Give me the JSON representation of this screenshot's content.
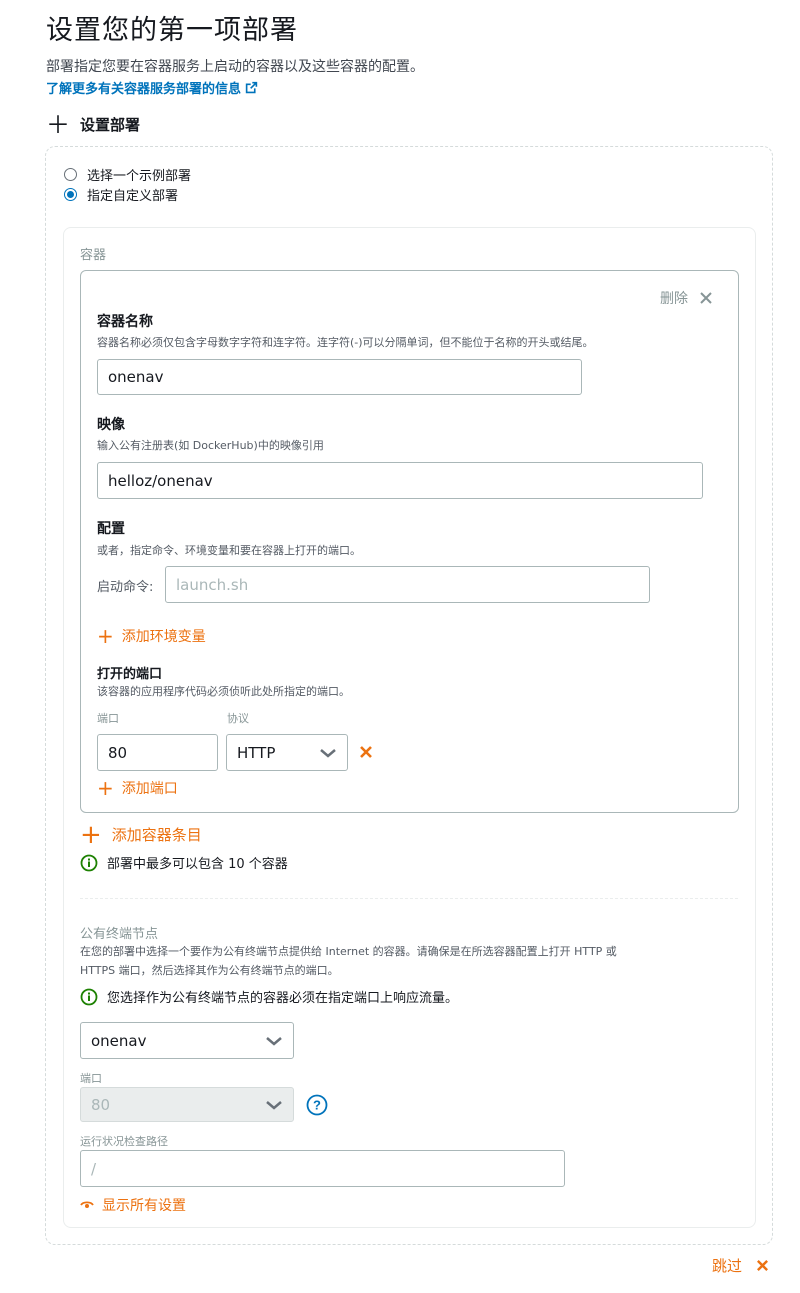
{
  "header": {
    "title": "设置您的第一项部署",
    "description": "部署指定您要在容器服务上启动的容器以及这些容器的配置。",
    "learn_more": "了解更多有关容器服务部署的信息"
  },
  "setup_section": {
    "title": "设置部署",
    "options": [
      {
        "label": "选择一个示例部署",
        "checked": false
      },
      {
        "label": "指定自定义部署",
        "checked": true
      }
    ]
  },
  "containers": {
    "section_label": "容器",
    "card": {
      "delete_label": "删除",
      "name": {
        "title": "容器名称",
        "hint": "容器名称必须仅包含字母数字字符和连字符。连字符(-)可以分隔单词，但不能位于名称的开头或结尾。",
        "value": "onenav"
      },
      "image": {
        "title": "映像",
        "hint": "输入公有注册表(如 DockerHub)中的映像引用",
        "value": "helloz/onenav"
      },
      "config": {
        "title": "配置",
        "hint": "或者，指定命令、环境变量和要在容器上打开的端口。",
        "launch_label": "启动命令:",
        "launch_placeholder": "launch.sh",
        "add_env": "添加环境变量"
      },
      "ports": {
        "title": "打开的端口",
        "hint": "该容器的应用程序代码必须侦听此处所指定的端口。",
        "port_label": "端口",
        "protocol_label": "协议",
        "port_value": "80",
        "protocol_value": "HTTP",
        "add_port": "添加端口"
      }
    },
    "add_container": "添加容器条目",
    "max_info": "部署中最多可以包含 10 个容器"
  },
  "endpoint": {
    "title": "公有终端节点",
    "description_line1": "在您的部署中选择一个要作为公有终端节点提供给 Internet 的容器。请确保是在所选容器配置上打开 HTTP 或",
    "description_line2": "HTTPS 端口，然后选择其作为公有终端节点的端口。",
    "info": "您选择作为公有终端节点的容器必须在指定端口上响应流量。",
    "container_value": "onenav",
    "port_label": "端口",
    "port_value": "80",
    "health_label": "运行状况检查路径",
    "health_value": "/",
    "show_all": "显示所有设置"
  },
  "footer": {
    "skip": "跳过"
  },
  "colors": {
    "accent_orange": "#ec7211",
    "link_blue": "#0073bb",
    "info_green": "#1d8102"
  }
}
